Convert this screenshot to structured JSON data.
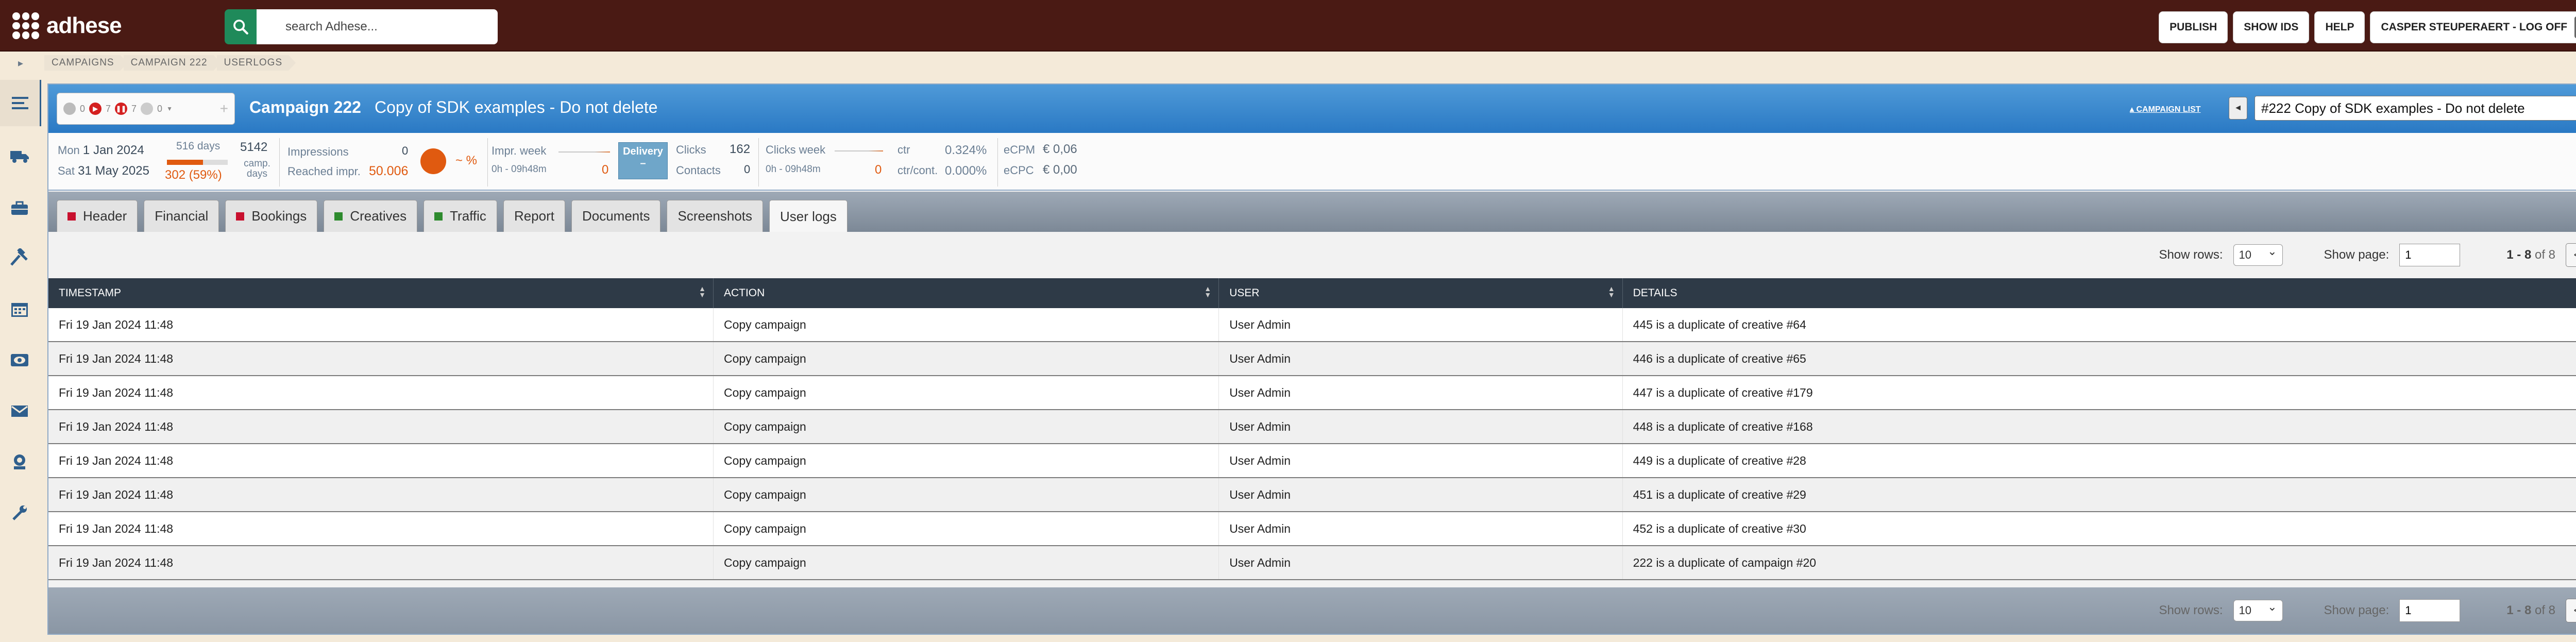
{
  "header": {
    "brand": "adhese",
    "search_placeholder": "search Adhese...",
    "buttons": {
      "publish": "PUBLISH",
      "show_ids": "SHOW IDS",
      "help": "HELP",
      "user": "CASPER STEUPERAERT - LOG OFF"
    }
  },
  "breadcrumb": [
    "CAMPAIGNS",
    "CAMPAIGN 222",
    "USERLOGS"
  ],
  "sidebar": [
    "list-icon",
    "truck-icon",
    "briefcase-icon",
    "tools-icon",
    "calendar-icon",
    "eye-icon",
    "mail-icon",
    "user-icon",
    "wrench-icon"
  ],
  "campaign": {
    "status": {
      "a": "0",
      "b": "7",
      "c": "7",
      "d": "0"
    },
    "number": "Campaign 222",
    "name": "Copy of SDK examples - Do not delete",
    "list_link": "▴ CAMPAIGN LIST",
    "selector": "#222 Copy of SDK examples - Do not delete",
    "prev": "◄",
    "next": "►"
  },
  "stats": {
    "start_day": "Mon",
    "start_date": "1 Jan 2024",
    "end_day": "Sat",
    "end_date": "31 May 2025",
    "days_total": "516 days",
    "days_elapsed": "302 (59%)",
    "progress_pct": 59,
    "camp_days_value": "5142",
    "camp_days_label": "camp. days",
    "impressions_label": "Impressions",
    "impressions_value": "0",
    "reached_label": "Reached impr.",
    "reached_value": "50.006",
    "pct": "~ %",
    "impr_week_label": "Impr. week",
    "impr_week_time": "0h - 09h48m",
    "impr_week_value": "0",
    "delivery_label": "Delivery",
    "delivery_value": "–",
    "clicks_label": "Clicks",
    "clicks_value": "162",
    "contacts_label": "Contacts",
    "contacts_value": "0",
    "clicks_week_label": "Clicks week",
    "clicks_week_time": "0h - 09h48m",
    "clicks_week_value": "0",
    "ctr_label": "ctr",
    "ctr_value": "0.324%",
    "ctr_cont_label": "ctr/cont.",
    "ctr_cont_value": "0.000%",
    "ecpm_label": "eCPM",
    "ecpm_value": "€ 0,06",
    "ecpc_label": "eCPC",
    "ecpc_value": "€ 0,00"
  },
  "tabs": [
    {
      "label": "Header",
      "marker": "#c8102e"
    },
    {
      "label": "Financial",
      "marker": ""
    },
    {
      "label": "Bookings",
      "marker": "#c8102e"
    },
    {
      "label": "Creatives",
      "marker": "#2e8b2e"
    },
    {
      "label": "Traffic",
      "marker": "#2e8b2e"
    },
    {
      "label": "Report",
      "marker": ""
    },
    {
      "label": "Documents",
      "marker": ""
    },
    {
      "label": "Screenshots",
      "marker": ""
    },
    {
      "label": "User logs",
      "marker": ""
    }
  ],
  "pager": {
    "rows_label": "Show rows:",
    "rows_value": "10",
    "page_label": "Show page:",
    "page_value": "1",
    "range": "1 - 8",
    "of": "of 8",
    "prev": "<",
    "next": ">"
  },
  "table": {
    "columns": [
      "TIMESTAMP",
      "ACTION",
      "USER",
      "DETAILS"
    ],
    "rows": [
      [
        "Fri 19 Jan 2024 11:48",
        "Copy campaign",
        "User Admin",
        "445 is a duplicate of creative #64"
      ],
      [
        "Fri 19 Jan 2024 11:48",
        "Copy campaign",
        "User Admin",
        "446 is a duplicate of creative #65"
      ],
      [
        "Fri 19 Jan 2024 11:48",
        "Copy campaign",
        "User Admin",
        "447 is a duplicate of creative #179"
      ],
      [
        "Fri 19 Jan 2024 11:48",
        "Copy campaign",
        "User Admin",
        "448 is a duplicate of creative #168"
      ],
      [
        "Fri 19 Jan 2024 11:48",
        "Copy campaign",
        "User Admin",
        "449 is a duplicate of creative #28"
      ],
      [
        "Fri 19 Jan 2024 11:48",
        "Copy campaign",
        "User Admin",
        "451 is a duplicate of creative #29"
      ],
      [
        "Fri 19 Jan 2024 11:48",
        "Copy campaign",
        "User Admin",
        "452 is a duplicate of creative #30"
      ],
      [
        "Fri 19 Jan 2024 11:48",
        "Copy campaign",
        "User Admin",
        "222 is a duplicate of campaign #20"
      ]
    ]
  }
}
